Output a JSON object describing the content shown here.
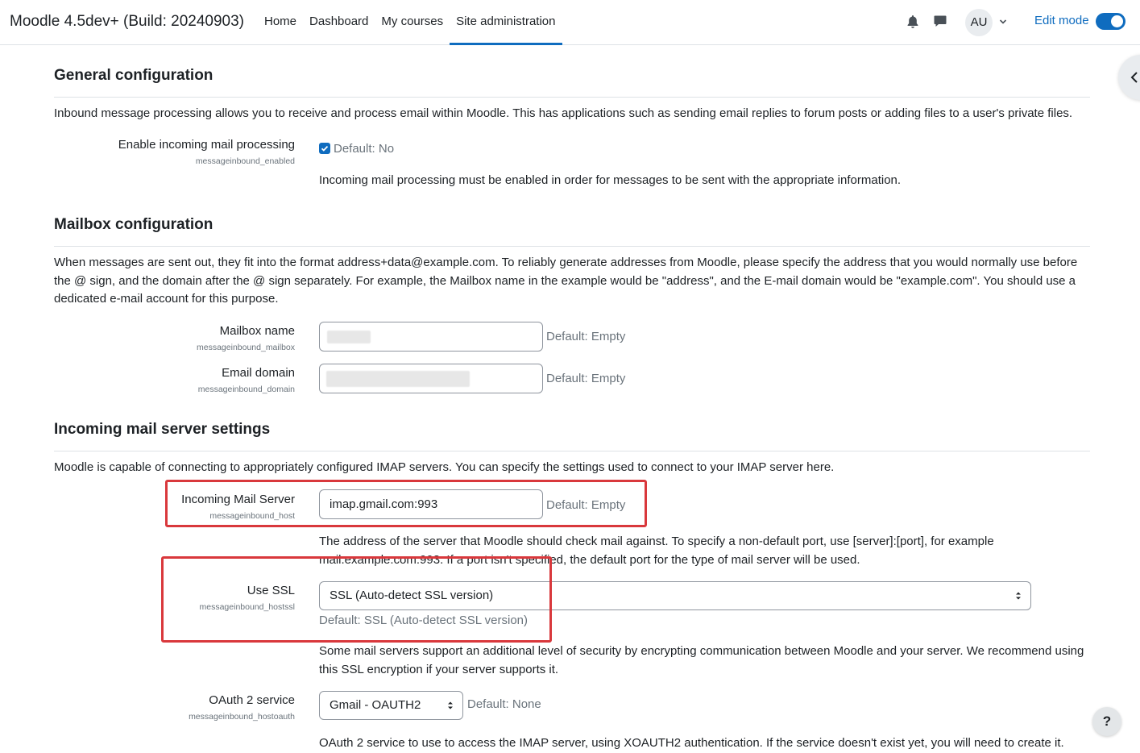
{
  "navbar": {
    "brand": "Moodle 4.5dev+ (Build: 20240903)",
    "links": [
      "Home",
      "Dashboard",
      "My courses",
      "Site administration"
    ],
    "active_link": "Site administration",
    "avatar_initials": "AU",
    "edit_mode_label": "Edit mode",
    "edit_mode_on": true
  },
  "sections": {
    "general": {
      "title": "General configuration",
      "description": "Inbound message processing allows you to receive and process email within Moodle. This has applications such as sending email replies to forum posts or adding files to a user's private files.",
      "enable_label": "Enable incoming mail processing",
      "enable_key": "messageinbound_enabled",
      "enable_checked": true,
      "enable_default": "Default: No",
      "enable_help": "Incoming mail processing must be enabled in order for messages to be sent with the appropriate information."
    },
    "mailbox": {
      "title": "Mailbox configuration",
      "description": "When messages are sent out, they fit into the format address+data@example.com. To reliably generate addresses from Moodle, please specify the address that you would normally use before the @ sign, and the domain after the @ sign separately. For example, the Mailbox name in the example would be \"address\", and the E-mail domain would be \"example.com\". You should use a dedicated e-mail account for this purpose.",
      "mailbox_label": "Mailbox name",
      "mailbox_key": "messageinbound_mailbox",
      "mailbox_default": "Default: Empty",
      "domain_label": "Email domain",
      "domain_key": "messageinbound_domain",
      "domain_default": "Default: Empty"
    },
    "server": {
      "title": "Incoming mail server settings",
      "description": "Moodle is capable of connecting to appropriately configured IMAP servers. You can specify the settings used to connect to your IMAP server here.",
      "host_label": "Incoming Mail Server",
      "host_key": "messageinbound_host",
      "host_value": "imap.gmail.com:993",
      "host_default": "Default: Empty",
      "host_help_line1": "The address of the server that Moodle should check mail against. To specify a non-default port, use [server]:[port], for example",
      "host_help_line2": "mail.example.com:993. If a port isn't specified, the default port for the type of mail server will be used.",
      "ssl_label": "Use SSL",
      "ssl_key": "messageinbound_hostssl",
      "ssl_value": "SSL (Auto-detect SSL version)",
      "ssl_default": "Default: SSL (Auto-detect SSL version)",
      "ssl_help_line1": "Some mail servers support an additional level of security by encrypting communication between Moodle and your server. We recommend using",
      "ssl_help_line2": "this SSL encryption if your server supports it.",
      "oauth_label": "OAuth 2 service",
      "oauth_key": "messageinbound_hostoauth",
      "oauth_value": "Gmail - OAUTH2",
      "oauth_default": "Default: None",
      "oauth_help": "OAuth 2 service to use to access the IMAP server, using XOAUTH2 authentication. If the service doesn't exist yet, you will need to create it."
    }
  },
  "help_button": "?",
  "colors": {
    "accent": "#0f6cbf",
    "highlight_box": "#d9383c"
  }
}
